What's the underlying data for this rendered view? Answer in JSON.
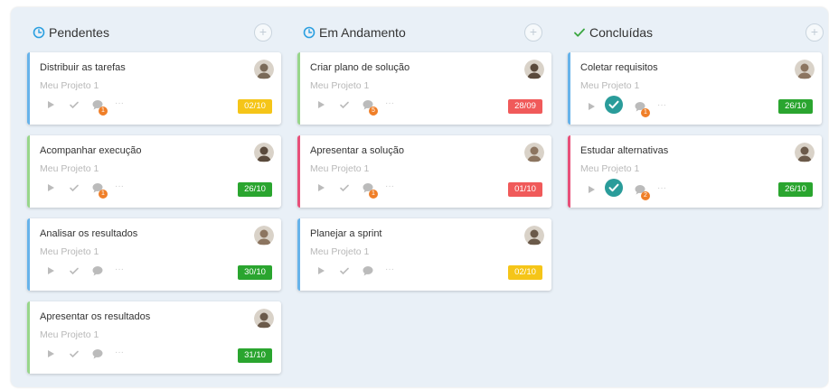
{
  "colors": {
    "board_bg": "#e9f0f7",
    "pending_clock": "#2b9fe0",
    "in_progress_clock": "#2b9fe0",
    "done_check": "#3aa640",
    "badge_green": "#2aa52f",
    "badge_red": "#f05a5a",
    "badge_yellow": "#f5c518",
    "comment_orange": "#f07f28",
    "completed_teal": "#2a9c9a"
  },
  "columns": [
    {
      "title": "Pendentes",
      "icon": "clock-icon",
      "cards": [
        {
          "title": "Distribuir as tarefas",
          "project": "Meu Projeto 1",
          "date": "02/10",
          "date_color": "#f5c518",
          "border": "#67b3ea",
          "comment_count": "1",
          "completed": false
        },
        {
          "title": "Acompanhar execução",
          "project": "Meu Projeto 1",
          "date": "26/10",
          "date_color": "#2aa52f",
          "border": "#98d68b",
          "comment_count": "1",
          "completed": false
        },
        {
          "title": "Analisar os resultados",
          "project": "Meu Projeto 1",
          "date": "30/10",
          "date_color": "#2aa52f",
          "border": "#67b3ea",
          "comment_count": "",
          "completed": false
        },
        {
          "title": "Apresentar os resultados",
          "project": "Meu Projeto 1",
          "date": "31/10",
          "date_color": "#2aa52f",
          "border": "#98d68b",
          "comment_count": "",
          "completed": false
        }
      ]
    },
    {
      "title": "Em Andamento",
      "icon": "clock-icon",
      "cards": [
        {
          "title": "Criar plano de solução",
          "project": "Meu Projeto 1",
          "date": "28/09",
          "date_color": "#f05a5a",
          "border": "#98d68b",
          "comment_count": "5",
          "completed": false
        },
        {
          "title": "Apresentar a solução",
          "project": "Meu Projeto 1",
          "date": "01/10",
          "date_color": "#f05a5a",
          "border": "#e8507a",
          "comment_count": "1",
          "completed": false
        },
        {
          "title": "Planejar a sprint",
          "project": "Meu Projeto 1",
          "date": "02/10",
          "date_color": "#f5c518",
          "border": "#67b3ea",
          "comment_count": "",
          "completed": false
        }
      ]
    },
    {
      "title": "Concluídas",
      "icon": "check-icon",
      "cards": [
        {
          "title": "Coletar requisitos",
          "project": "Meu Projeto 1",
          "date": "26/10",
          "date_color": "#2aa52f",
          "border": "#67b3ea",
          "comment_count": "1",
          "completed": true
        },
        {
          "title": "Estudar alternativas",
          "project": "Meu Projeto 1",
          "date": "26/10",
          "date_color": "#2aa52f",
          "border": "#e8507a",
          "comment_count": "2",
          "completed": true
        }
      ]
    }
  ],
  "add_label": "+",
  "more_label": "···"
}
